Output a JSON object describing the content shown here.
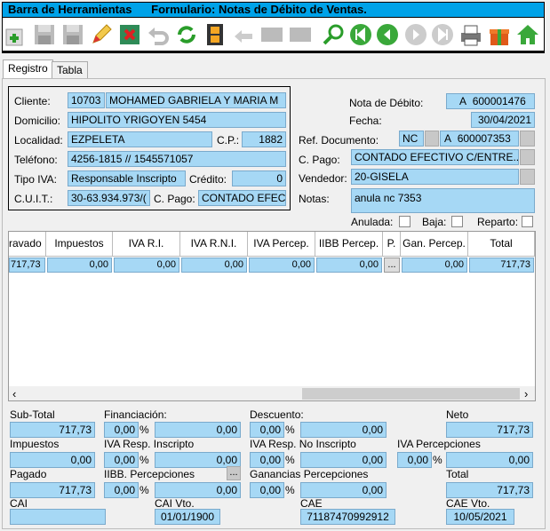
{
  "window": {
    "title": "Barra de Herramientas",
    "form_title": "Formulario: Notas de Débito de Ventas."
  },
  "toolbar": {
    "icons": [
      "add-icon",
      "save-icon",
      "save-as-icon",
      "edit-icon",
      "delete-icon",
      "undo-icon",
      "refresh-icon",
      "film-icon",
      "back-arrow-icon",
      "grid-icon",
      "grid2-icon",
      "search-icon",
      "first-icon",
      "prev-icon",
      "next-icon",
      "last-icon",
      "print-icon",
      "gift-icon",
      "home-icon"
    ]
  },
  "tabs": {
    "registro": "Registro",
    "tabla": "Tabla"
  },
  "cliente": {
    "label": "Cliente:",
    "code": "10703",
    "name": "MOHAMED GABRIELA Y MARIA M"
  },
  "domicilio": {
    "label": "Domicilio:",
    "value": "HIPOLITO YRIGOYEN 5454"
  },
  "localidad": {
    "label": "Localidad:",
    "value": "EZPELETA",
    "cp_label": "C.P.:",
    "cp": "1882"
  },
  "telefono": {
    "label": "Teléfono:",
    "value": "4256-1815 // 1545571057"
  },
  "tipo_iva": {
    "label": "Tipo IVA:",
    "value": "Responsable Inscripto",
    "credito_label": "Crédito:",
    "credito": "0"
  },
  "cuit": {
    "label": "C.U.I.T.:",
    "value": "30-63.934.973/(",
    "cpago_label": "C. Pago:",
    "cpago": "CONTADO EFEC"
  },
  "nota": {
    "label": "Nota de Débito:",
    "tipo": "A",
    "numero": "600001476"
  },
  "fecha": {
    "label": "Fecha:",
    "value": "30/04/2021"
  },
  "ref": {
    "label": "Ref. Documento:",
    "tipo": "NC",
    "letra": "A",
    "numero": "600007353"
  },
  "cpago2": {
    "label": "C. Pago:",
    "value": "CONTADO EFECTIVO C/ENTRE..."
  },
  "vendedor": {
    "label": "Vendedor:",
    "value": "20-GISELA"
  },
  "notas": {
    "label": "Notas:",
    "value": "anula nc 7353"
  },
  "flags": {
    "anulada": "Anulada:",
    "baja": "Baja:",
    "reparto": "Reparto:"
  },
  "grid": {
    "headers": [
      "ravado",
      "Impuestos",
      "IVA R.I.",
      "IVA R.N.I.",
      "IVA Percep.",
      "IIBB Percep.",
      "P.",
      "Gan. Percep.",
      "Total"
    ],
    "row": [
      "717,73",
      "0,00",
      "0,00",
      "0,00",
      "0,00",
      "0,00",
      "...",
      "0,00",
      "717,73"
    ]
  },
  "totals": {
    "subtotal_label": "Sub-Total",
    "subtotal": "717,73",
    "financiacion_label": "Financiación:",
    "fin_pct": "0,00",
    "fin_val": "0,00",
    "descuento_label": "Descuento:",
    "desc_pct": "0,00",
    "desc_val": "0,00",
    "neto_label": "Neto",
    "neto": "717,73",
    "impuestos_label": "Impuestos",
    "impuestos": "0,00",
    "iva_ri_label": "IVA Resp. Inscripto",
    "iva_ri_pct": "0,00",
    "iva_ri_val": "0,00",
    "iva_rni_label": "IVA Resp. No Inscripto",
    "iva_rni_pct": "0,00",
    "iva_rni_val": "0,00",
    "iva_perc_label": "IVA Percepciones",
    "iva_perc_pct": "0,00",
    "iva_perc_val": "0,00",
    "pagado_label": "Pagado",
    "pagado": "717,73",
    "iibb_label": "IIBB. Percepciones",
    "iibb_pct": "0,00",
    "iibb_val": "0,00",
    "gan_label": "Ganancias Percepciones",
    "gan_pct": "0,00",
    "gan_val": "0,00",
    "total_label": "Total",
    "total": "717,73",
    "cai_label": "CAI",
    "cai": "",
    "cai_vto_label": "CAI Vto.",
    "cai_vto": "01/01/1900",
    "cae_label": "CAE",
    "cae": "71187470992912",
    "cae_vto_label": "CAE Vto.",
    "cae_vto": "10/05/2021",
    "pct": "%",
    "ellipsis": "..."
  },
  "colors": {
    "field": "#a6d8f5",
    "title": "#00a2e8"
  }
}
